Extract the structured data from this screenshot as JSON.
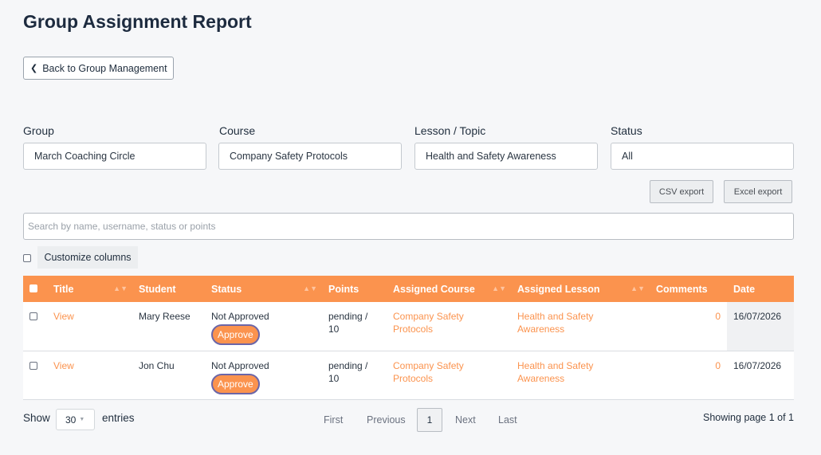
{
  "page_title": "Group Assignment Report",
  "back_button": "Back to Group Management",
  "filters": {
    "group": {
      "label": "Group",
      "value": "March Coaching Circle"
    },
    "course": {
      "label": "Course",
      "value": "Company Safety Protocols"
    },
    "lesson": {
      "label": "Lesson / Topic",
      "value": "Health and Safety Awareness"
    },
    "status": {
      "label": "Status",
      "value": "All"
    }
  },
  "exports": {
    "csv": "CSV export",
    "excel": "Excel export"
  },
  "search": {
    "placeholder": "Search by name, username, status or points"
  },
  "customize_columns": "Customize columns",
  "table": {
    "headers": [
      "Title",
      "Student",
      "Status",
      "Points",
      "Assigned Course",
      "Assigned Lesson",
      "Comments",
      "Date"
    ],
    "rows": [
      {
        "title": "View",
        "student": "Mary Reese",
        "status": "Not Approved",
        "action": "Approve",
        "points": "pending / 10",
        "course": "Company Safety Protocols",
        "lesson": "Health and Safety Awareness",
        "comments": "0",
        "date": "16/07/2026"
      },
      {
        "title": "View",
        "student": "Jon Chu",
        "status": "Not Approved",
        "action": "Approve",
        "points": "pending / 10",
        "course": "Company Safety Protocols",
        "lesson": "Health and Safety Awareness",
        "comments": "0",
        "date": "16/07/2026"
      }
    ]
  },
  "footer": {
    "show": "Show",
    "entries_value": "30",
    "entries": "entries",
    "first": "First",
    "previous": "Previous",
    "page": "1",
    "next": "Next",
    "last": "Last",
    "page_info": "Showing page 1 of 1"
  },
  "colors": {
    "accent": "#fb934e",
    "approve_border": "#6b66a8"
  }
}
